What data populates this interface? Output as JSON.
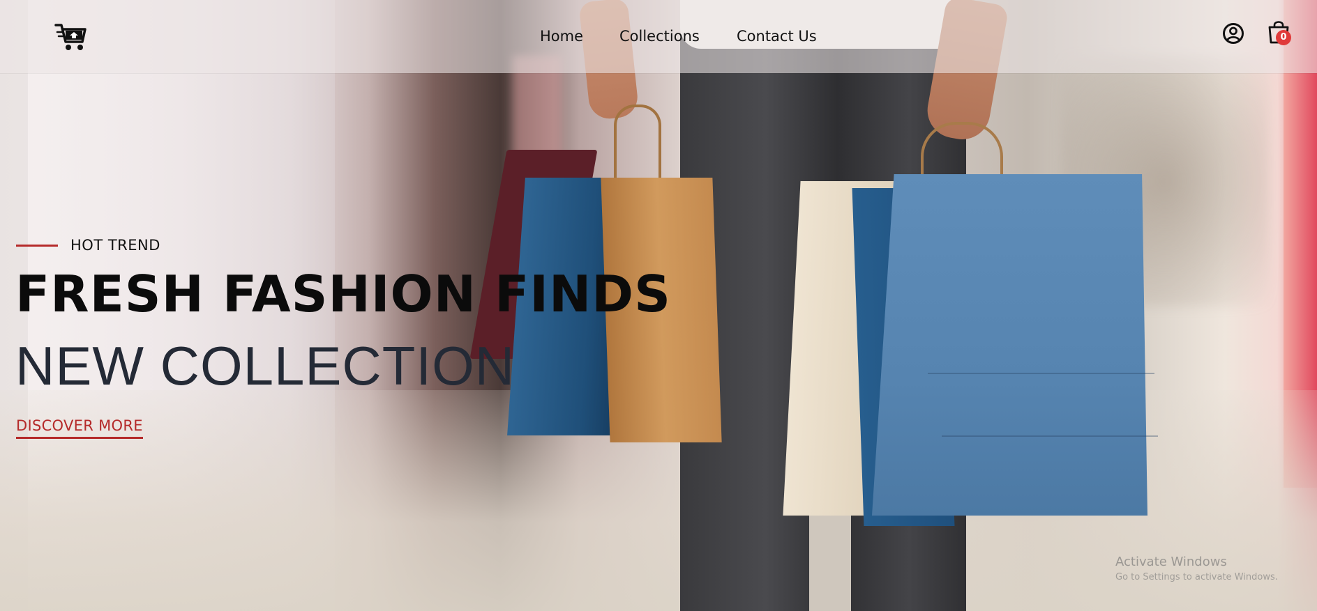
{
  "header": {
    "logo_icon": "cart-logo-icon",
    "nav": [
      {
        "label": "Home"
      },
      {
        "label": "Collections"
      },
      {
        "label": "Contact Us"
      }
    ],
    "user_icon": "user-circle-icon",
    "cart_icon": "shopping-bag-icon",
    "cart_count": "0"
  },
  "hero": {
    "eyebrow": "HOT TREND",
    "title": "FRESH FASHION FINDS",
    "subtitle": "NEW COLLECTION",
    "cta": "DISCOVER MORE",
    "accent_color": "#b52a2a"
  },
  "watermark": {
    "title": "Activate Windows",
    "subtitle": "Go to Settings to activate Windows."
  }
}
